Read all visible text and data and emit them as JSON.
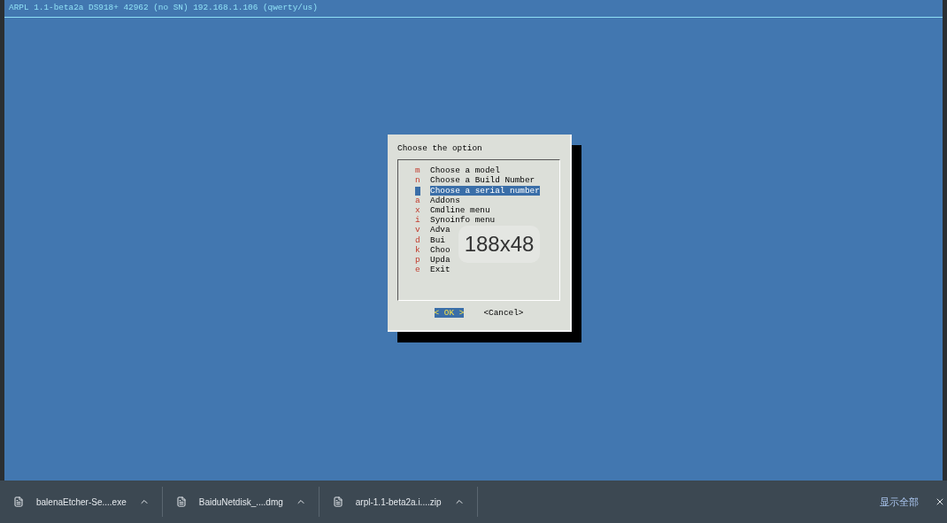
{
  "terminal": {
    "header": "ARPL 1.1-beta2a DS918+ 42962 (no SN) 192.168.1.106 (qwerty/us)"
  },
  "dialog": {
    "title": "Choose the option",
    "items": [
      {
        "key": "m",
        "label": "Choose a model",
        "selected": false
      },
      {
        "key": "n",
        "label": "Choose a Build Number",
        "selected": false
      },
      {
        "label": "Choose a serial number",
        "selected": true
      },
      {
        "key": "a",
        "label": "Addons",
        "selected": false
      },
      {
        "key": "x",
        "label": "Cmdline menu",
        "selected": false
      },
      {
        "key": "i",
        "label": "Synoinfo menu",
        "selected": false
      },
      {
        "key": "v",
        "label": "Adva",
        "selected": false
      },
      {
        "key": "d",
        "label": "Bui",
        "selected": false
      },
      {
        "key": "k",
        "label": "Choo",
        "selected": false
      },
      {
        "key": "p",
        "label": "Upda",
        "selected": false
      },
      {
        "key": "e",
        "label": "Exit",
        "selected": false
      }
    ],
    "buttons": [
      {
        "label": "< OK >",
        "selected": true
      },
      {
        "label": "<Cancel>",
        "selected": false
      }
    ]
  },
  "size_overlay": "188x48",
  "downloads": {
    "items": [
      {
        "name": "balenaEtcher-Se....exe"
      },
      {
        "name": "BaiduNetdisk_....dmg"
      },
      {
        "name": "arpl-1.1-beta2a.i....zip"
      }
    ],
    "show_all": "显示全部"
  }
}
